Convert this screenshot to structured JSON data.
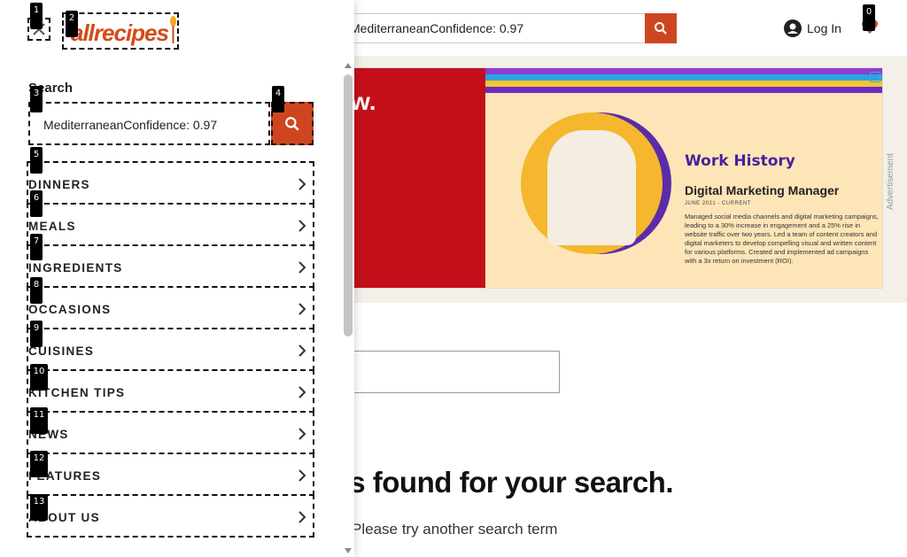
{
  "header": {
    "search_value": "MediterraneanConfidence: 0.97",
    "login_label": "Log In"
  },
  "ad": {
    "headline_fragment": "w.",
    "card_title": "Work History",
    "card_role": "Digital Marketing Manager",
    "card_date": "JUNE 2021 - CURRENT",
    "card_body": "Managed social media channels and digital marketing campaigns, leading to a 30% increase in engagement and a 25% rise in website traffic over two years. Led a team of content creators and digital marketers to develop compelling visual and written content for various platforms. Created and implemented ad campaigns with a 3x return on investment (ROI).",
    "label": "Advertisement"
  },
  "results": {
    "heading_fragment": "s found for your search.",
    "hint": "Please try another search term"
  },
  "drawer": {
    "logo_text": "allrecipes",
    "search_label": "Search",
    "search_value": "MediterraneanConfidence: 0.97",
    "menu": [
      {
        "label": "DINNERS"
      },
      {
        "label": "MEALS"
      },
      {
        "label": "INGREDIENTS"
      },
      {
        "label": "OCCASIONS"
      },
      {
        "label": "CUISINES"
      },
      {
        "label": "KITCHEN TIPS"
      },
      {
        "label": "NEWS"
      },
      {
        "label": "FEATURES"
      },
      {
        "label": "ABOUT US"
      }
    ]
  },
  "markers": [
    "0",
    "1",
    "2",
    "3",
    "4",
    "5",
    "6",
    "7",
    "8",
    "9",
    "10",
    "11",
    "12",
    "13"
  ],
  "colors": {
    "accent": "#ce4620",
    "logo": "#d54a1c",
    "ad_red": "#c40f1a",
    "ad_cream": "#fde5b8"
  }
}
